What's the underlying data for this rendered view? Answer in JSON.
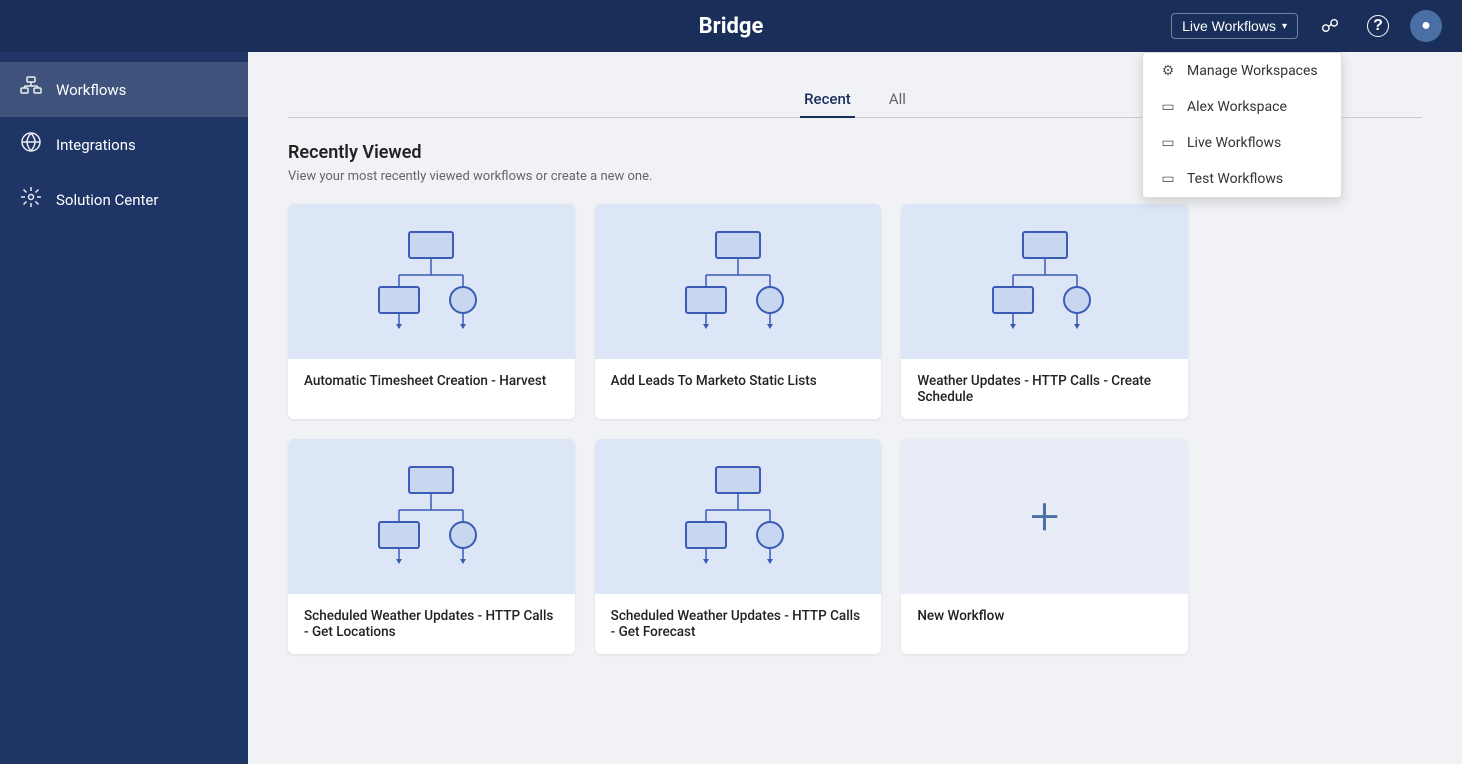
{
  "app": {
    "title": "Bridge"
  },
  "topNav": {
    "workspace_btn_label": "Live Workflows",
    "chat_icon": "💬",
    "help_icon": "?",
    "avatar_icon": "👤"
  },
  "dropdown": {
    "items": [
      {
        "id": "manage-workspaces",
        "label": "Manage Workspaces",
        "icon": "⚙"
      },
      {
        "id": "alex-workspace",
        "label": "Alex Workspace",
        "icon": "▭"
      },
      {
        "id": "live-workflows",
        "label": "Live Workflows",
        "icon": "▭"
      },
      {
        "id": "test-workflows",
        "label": "Test Workflows",
        "icon": "▭"
      }
    ]
  },
  "sidebar": {
    "items": [
      {
        "id": "workflows",
        "label": "Workflows",
        "active": true
      },
      {
        "id": "integrations",
        "label": "Integrations",
        "active": false
      },
      {
        "id": "solution-center",
        "label": "Solution Center",
        "active": false
      }
    ]
  },
  "tabs": [
    {
      "id": "recent",
      "label": "Recent",
      "active": true
    },
    {
      "id": "all",
      "label": "All",
      "active": false
    }
  ],
  "section": {
    "title": "Recently Viewed",
    "subtitle": "View your most recently viewed workflows or create a new one."
  },
  "workflows": [
    {
      "id": 1,
      "label": "Automatic Timesheet Creation - Harvest"
    },
    {
      "id": 2,
      "label": "Add Leads To Marketo Static Lists"
    },
    {
      "id": 3,
      "label": "Weather Updates - HTTP Calls - Create Schedule"
    },
    {
      "id": 4,
      "label": "Scheduled Weather Updates - HTTP Calls - Get Locations"
    },
    {
      "id": 5,
      "label": "Scheduled Weather Updates - HTTP Calls - Get Forecast"
    },
    {
      "id": 6,
      "label": "New Workflow",
      "isNew": true
    }
  ]
}
